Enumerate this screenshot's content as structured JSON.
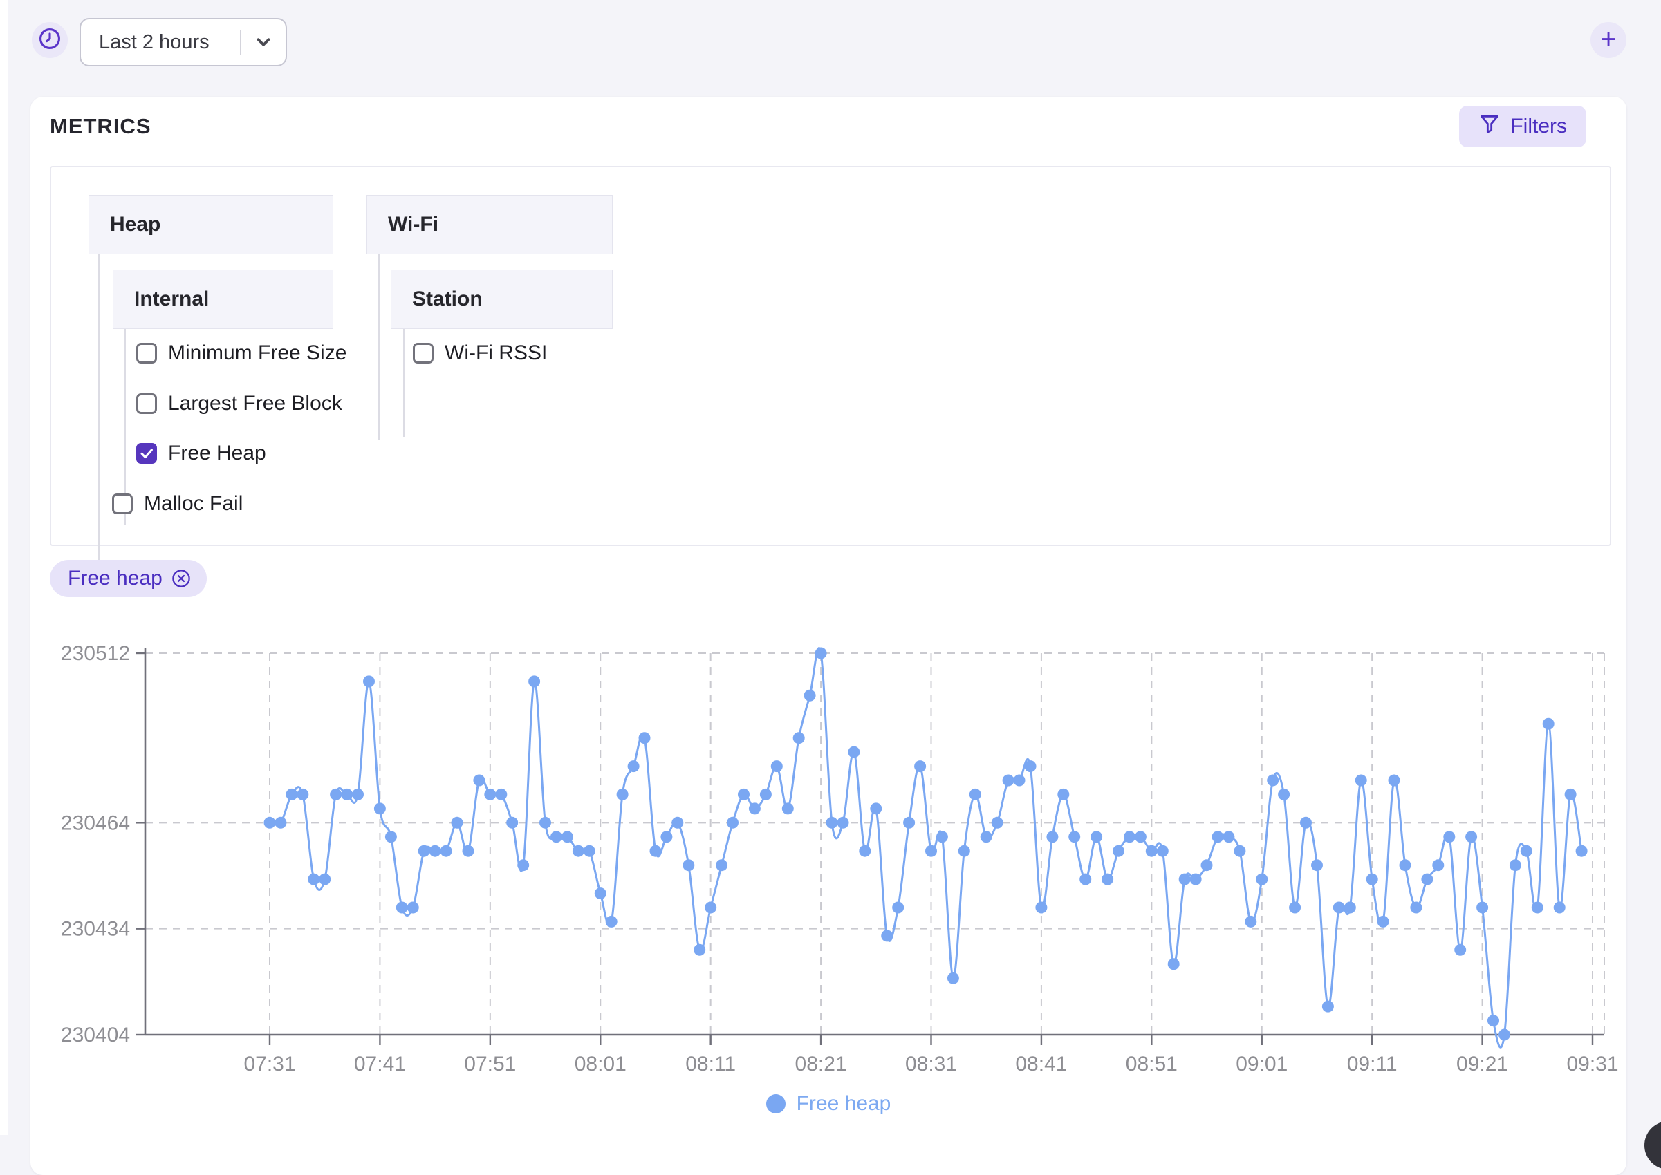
{
  "topbar": {
    "time_range_value": "Last 2 hours"
  },
  "panel": {
    "title": "METRICS",
    "filters_label": "Filters"
  },
  "tree": {
    "heap_label": "Heap",
    "wifi_label": "Wi-Fi",
    "internal_label": "Internal",
    "station_label": "Station",
    "checkboxes": {
      "minimum_free_size": {
        "label": "Minimum Free Size",
        "checked": false
      },
      "largest_free_block": {
        "label": "Largest Free Block",
        "checked": false
      },
      "free_heap": {
        "label": "Free Heap",
        "checked": true
      },
      "malloc_fail": {
        "label": "Malloc Fail",
        "checked": false
      },
      "wifi_rssi": {
        "label": "Wi-Fi RSSI",
        "checked": false
      }
    }
  },
  "chip": {
    "label": "Free heap"
  },
  "icons": {
    "clock": "clock-icon",
    "chevron": "chevron-down-icon",
    "plus": "plus-icon",
    "funnel": "funnel-icon",
    "chip_close": "circle-x-icon",
    "legend_marker": "dot-icon"
  },
  "colors": {
    "accent_purple": "#5b35c9",
    "checkbox_checked_bg": "#5636bd",
    "series_blue": "#7aa7f2",
    "chip_bg": "#e7e3f9",
    "grid_gray": "#c9c9cf",
    "axis_gray": "#70707a",
    "tick_text_gray": "#8e8e93"
  },
  "chart_data": {
    "type": "line",
    "title": "",
    "xlabel": "",
    "ylabel": "",
    "grid": "dashed",
    "legend_position": "bottom",
    "series_name": "Free heap",
    "series_color": "#7aa7f2",
    "x_ticks": [
      "07:31",
      "07:41",
      "07:51",
      "08:01",
      "08:11",
      "08:21",
      "08:31",
      "08:41",
      "08:51",
      "09:01",
      "09:11",
      "09:21",
      "09:31"
    ],
    "y_ticks": [
      230512,
      230464,
      230434,
      230404
    ],
    "ylim": [
      230404,
      230512
    ],
    "x": [
      "07:31",
      "07:32",
      "07:33",
      "07:34",
      "07:35",
      "07:36",
      "07:37",
      "07:38",
      "07:39",
      "07:40",
      "07:41",
      "07:42",
      "07:43",
      "07:44",
      "07:45",
      "07:46",
      "07:47",
      "07:48",
      "07:49",
      "07:50",
      "07:51",
      "07:52",
      "07:53",
      "07:54",
      "07:55",
      "07:56",
      "07:57",
      "07:58",
      "07:59",
      "08:00",
      "08:01",
      "08:02",
      "08:03",
      "08:04",
      "08:05",
      "08:06",
      "08:07",
      "08:08",
      "08:09",
      "08:10",
      "08:11",
      "08:12",
      "08:13",
      "08:14",
      "08:15",
      "08:16",
      "08:17",
      "08:18",
      "08:19",
      "08:20",
      "08:21",
      "08:22",
      "08:23",
      "08:24",
      "08:25",
      "08:26",
      "08:27",
      "08:28",
      "08:29",
      "08:30",
      "08:31",
      "08:32",
      "08:33",
      "08:34",
      "08:35",
      "08:36",
      "08:37",
      "08:38",
      "08:39",
      "08:40",
      "08:41",
      "08:42",
      "08:43",
      "08:44",
      "08:45",
      "08:46",
      "08:47",
      "08:48",
      "08:49",
      "08:50",
      "08:51",
      "08:52",
      "08:53",
      "08:54",
      "08:55",
      "08:56",
      "08:57",
      "08:58",
      "08:59",
      "09:00",
      "09:01",
      "09:02",
      "09:03",
      "09:04",
      "09:05",
      "09:06",
      "09:07",
      "09:08",
      "09:09",
      "09:10",
      "09:11",
      "09:12",
      "09:13",
      "09:14",
      "09:15",
      "09:16",
      "09:17",
      "09:18",
      "09:19",
      "09:20",
      "09:21",
      "09:22",
      "09:23",
      "09:24",
      "09:25",
      "09:26",
      "09:27",
      "09:28",
      "09:29",
      "09:30"
    ],
    "values": [
      230464,
      230464,
      230472,
      230472,
      230448,
      230448,
      230472,
      230472,
      230472,
      230504,
      230468,
      230460,
      230440,
      230440,
      230456,
      230456,
      230456,
      230464,
      230456,
      230476,
      230472,
      230472,
      230464,
      230452,
      230504,
      230464,
      230460,
      230460,
      230456,
      230456,
      230444,
      230436,
      230472,
      230480,
      230488,
      230456,
      230460,
      230464,
      230452,
      230428,
      230440,
      230452,
      230464,
      230472,
      230468,
      230472,
      230480,
      230468,
      230488,
      230500,
      230512,
      230464,
      230464,
      230484,
      230456,
      230468,
      230432,
      230440,
      230464,
      230480,
      230456,
      230460,
      230420,
      230456,
      230472,
      230460,
      230464,
      230476,
      230476,
      230480,
      230440,
      230460,
      230472,
      230460,
      230448,
      230460,
      230448,
      230456,
      230460,
      230460,
      230456,
      230456,
      230424,
      230448,
      230448,
      230452,
      230460,
      230460,
      230456,
      230436,
      230448,
      230476,
      230472,
      230440,
      230464,
      230452,
      230412,
      230440,
      230440,
      230476,
      230448,
      230436,
      230476,
      230452,
      230440,
      230448,
      230452,
      230460,
      230428,
      230460,
      230440,
      230408,
      230404,
      230452,
      230456,
      230440,
      230492,
      230440,
      230472,
      230456
    ]
  }
}
